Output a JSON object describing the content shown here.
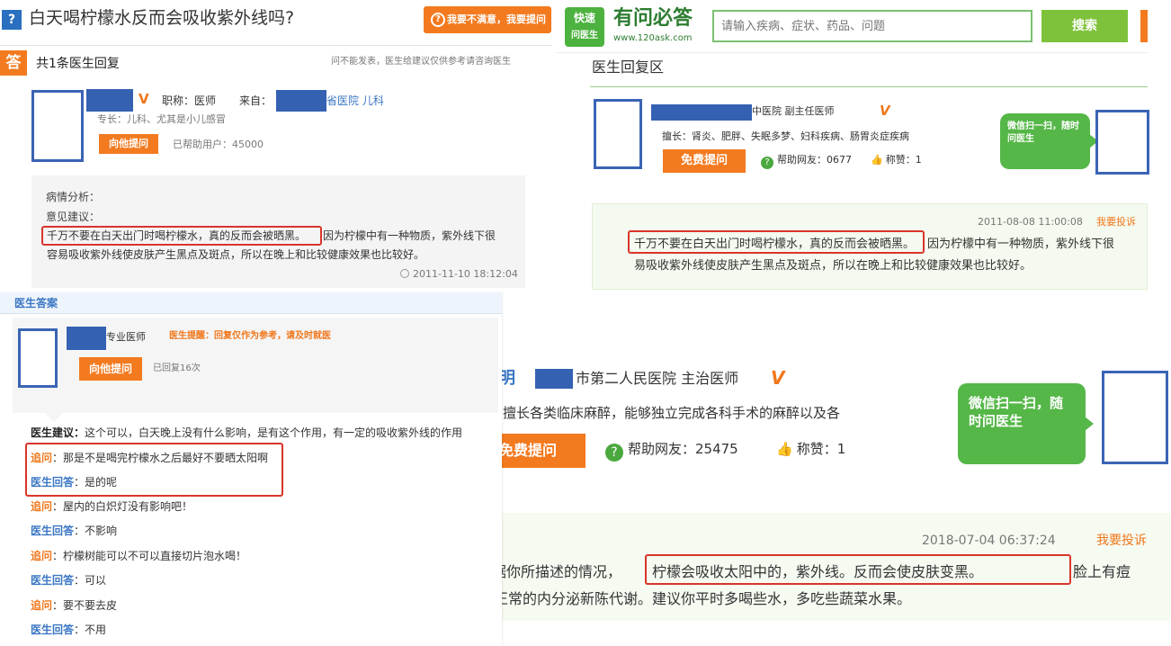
{
  "p1": {
    "logo_glyph": "?",
    "title": "白天喝柠檬水反而会吸收紫外线吗?",
    "ask_button": "我要不满意，我要提问",
    "ans_badge": "答",
    "count": "共1条医生回复",
    "note": "问不能发表，医生给建议仅供参考请咨询医生",
    "name_v": "V",
    "role": "职称：医师",
    "hospital_pre": "来自：",
    "hospital_post": "省医院 儿科",
    "specialty": "专长：儿科、尤其是小儿感冒",
    "btn": "向他提问",
    "helped": "已帮助用户：45000",
    "q1": "病情分析：",
    "q2": "意见建议：",
    "highlight": "千万不要在白天出门时喝柠檬水，真的反而会被晒黑。",
    "rest1": "因为柠檬中有一种物质，紫外线下很",
    "rest2": "容易吸收紫外线使皮肤产生黑点及斑点，所以在晚上和比较健康效果也比较好。",
    "time": "2011-11-10 18:12:04"
  },
  "p2": {
    "logo_line1": "快速",
    "logo_line2": "问医生",
    "brand": "有问必答",
    "url": "www.120ask.com",
    "search_placeholder": "请输入疾病、症状、药品、问题",
    "search_btn": "搜索",
    "section": "医生回复区",
    "hospital_post": "中医院 副主任医师",
    "v": "V",
    "specialty": "擅长：肾炎、肥胖、失眠多梦、妇科疾病、肠胃炎症疾病",
    "btn": "免费提问",
    "helped": "帮助网友：0677",
    "praise": "称赞：1",
    "bubble": "微信扫一扫，随时问医生",
    "time": "2011-08-08 11:00:08",
    "report": "我要投诉",
    "highlight": "千万不要在白天出门时喝柠檬水，真的反而会被晒黑。",
    "rest1": "因为柠檬中有一种物质，紫外线下很",
    "rest2": "易吸收紫外线使皮肤产生黑点及斑点，所以在晚上和比较健康效果也比较好。"
  },
  "p3": {
    "header": "医生答案",
    "title_post": "专业医师",
    "tag": "医生提醒：回复仅作为参考，请及时就医",
    "btn": "向他提问",
    "helped": "已回复16次",
    "advice_label": "医生建议：",
    "advice_text": "这个可以，白天晚上没有什么影响，是有这个作用，有一定的吸收紫外线的作用",
    "chat": [
      {
        "who": "追问",
        "text": "那是不是喝完柠檬水之后最好不要晒太阳啊"
      },
      {
        "who": "医生回答",
        "text": "是的呢"
      },
      {
        "who": "追问",
        "text": "屋内的白炽灯没有影响吧！"
      },
      {
        "who": "医生回答",
        "text": "不影响"
      },
      {
        "who": "追问",
        "text": "柠檬树能可以不可以直接切片泡水喝！"
      },
      {
        "who": "医生回答",
        "text": "可以"
      },
      {
        "who": "追问",
        "text": "要不要去皮"
      },
      {
        "who": "医生回答",
        "text": "不用"
      }
    ]
  },
  "p4": {
    "name_tail": "明",
    "hospital": "市第二人民医院 主治医师",
    "v": "V",
    "specialty": "擅长各类临床麻醉，能够独立完成各科手术的麻醉以及各",
    "btn": "免费提问",
    "helped": "帮助网友：25475",
    "praise": "称赞：1",
    "bubble": "微信扫一扫，随时问医生",
    "time": "2018-07-04 06:37:24",
    "report": "我要投诉",
    "pre": "据你所描述的情况，",
    "highlight": "柠檬会吸收太阳中的，紫外线。反而会使皮肤变黑。",
    "post": "脸上有痘",
    "line2": "正常的内分泌新陈代谢。建议你平时多喝些水，多吃些蔬菜水果。"
  }
}
